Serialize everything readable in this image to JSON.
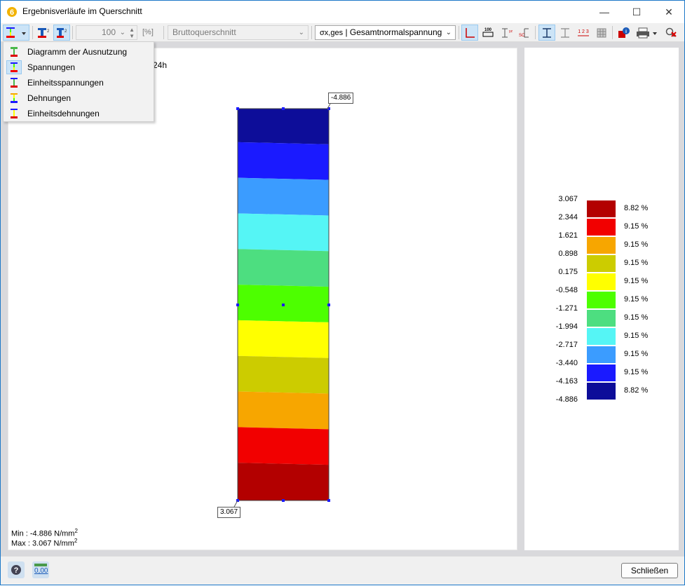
{
  "window": {
    "title": "Ergebnisverläufe im Querschnitt",
    "minimize_glyph": "—",
    "maximize_glyph": "☐",
    "close_glyph": "✕"
  },
  "toolbar": {
    "scale_value": "100",
    "scale_unit": "[%]",
    "section_combo": "Bruttoquerschnitt",
    "stress_combo_symbol": "σx,ges",
    "stress_combo_label": "Gesamtnormalspannung"
  },
  "menu": {
    "items": [
      {
        "label": "Diagramm der Ausnutzung"
      },
      {
        "label": "Spannungen"
      },
      {
        "label": "Einheitsspannungen"
      },
      {
        "label": "Dehnungen"
      },
      {
        "label": "Einheitsdehnungen"
      }
    ]
  },
  "canvas": {
    "partial_header": "24h",
    "top_label": "-4.886",
    "bottom_label": "3.067",
    "min_text": "Min : -4.886 N/mm",
    "max_text": "Max :  3.067 N/mm",
    "unit_sup": "2"
  },
  "legend": {
    "values": [
      "3.067",
      "2.344",
      "1.621",
      "0.898",
      "0.175",
      "-0.548",
      "-1.271",
      "-1.994",
      "-2.717",
      "-3.440",
      "-4.163",
      "-4.886"
    ],
    "bands": [
      {
        "color": "#b30000",
        "percent": "8.82 %"
      },
      {
        "color": "#f20000",
        "percent": "9.15 %"
      },
      {
        "color": "#f7a600",
        "percent": "9.15 %"
      },
      {
        "color": "#cccc00",
        "percent": "9.15 %"
      },
      {
        "color": "#ffff00",
        "percent": "9.15 %"
      },
      {
        "color": "#4dff00",
        "percent": "9.15 %"
      },
      {
        "color": "#4dde80",
        "percent": "9.15 %"
      },
      {
        "color": "#55f5f5",
        "percent": "9.15 %"
      },
      {
        "color": "#3b9cff",
        "percent": "9.15 %"
      },
      {
        "color": "#1a1aff",
        "percent": "9.15 %"
      },
      {
        "color": "#0d0d99",
        "percent": "8.82 %"
      }
    ]
  },
  "statusbar": {
    "close_label": "Schließen",
    "decimal_label": "0,00"
  }
}
